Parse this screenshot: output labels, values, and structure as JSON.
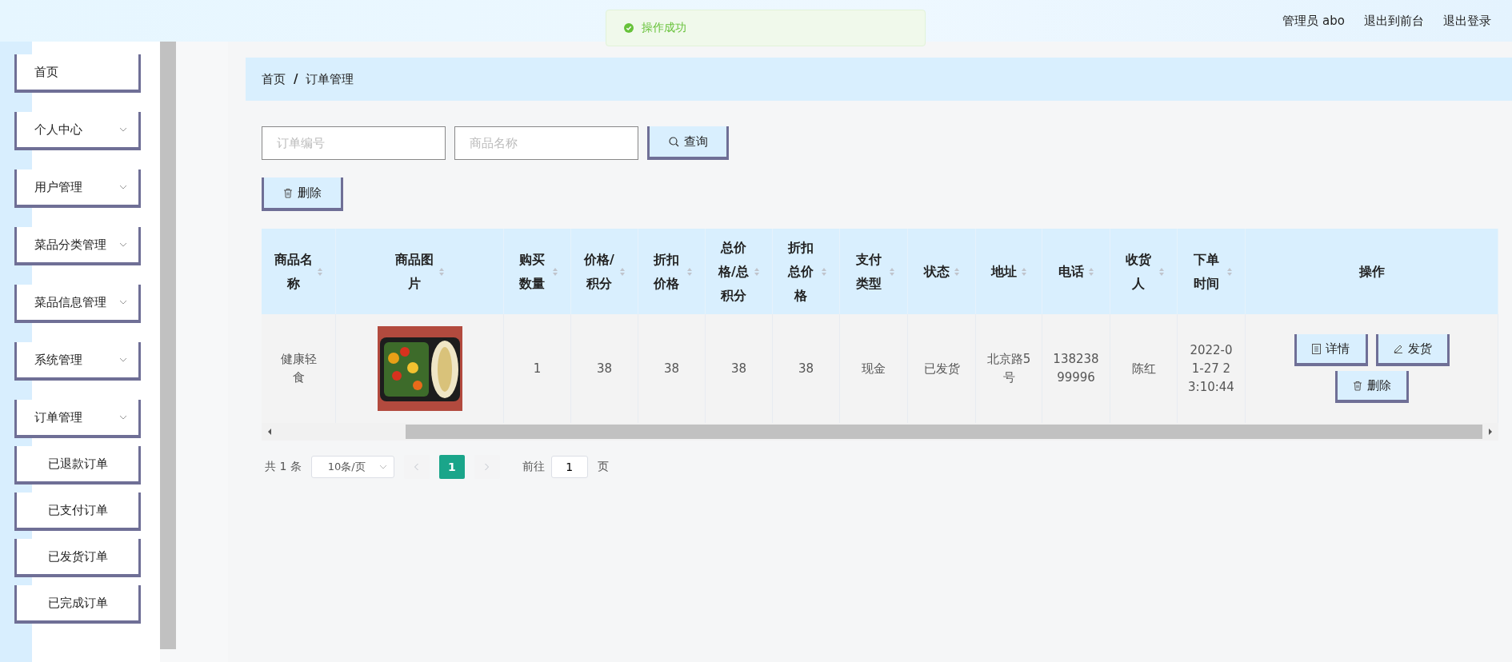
{
  "header": {
    "user_label": "管理员 abo",
    "links": [
      "退出到前台",
      "退出登录"
    ]
  },
  "toast": {
    "kind": "success",
    "message": "操作成功"
  },
  "sidebar": {
    "items": [
      {
        "label": "首页",
        "kind": "link"
      },
      {
        "label": "个人中心",
        "kind": "submenu"
      },
      {
        "label": "用户管理",
        "kind": "submenu"
      },
      {
        "label": "菜品分类管理",
        "kind": "submenu"
      },
      {
        "label": "菜品信息管理",
        "kind": "submenu"
      },
      {
        "label": "系统管理",
        "kind": "submenu"
      },
      {
        "label": "订单管理",
        "kind": "submenu",
        "children": [
          {
            "label": "已退款订单"
          },
          {
            "label": "已支付订单"
          },
          {
            "label": "已发货订单"
          },
          {
            "label": "已完成订单"
          }
        ]
      }
    ]
  },
  "breadcrumb": [
    "首页",
    "订单管理"
  ],
  "breadcrumb_separator": "/",
  "search": {
    "fields": [
      {
        "placeholder": "订单编号"
      },
      {
        "placeholder": "商品名称"
      }
    ],
    "button": "查询"
  },
  "toolbar": {
    "delete_button": "删除"
  },
  "table": {
    "columns": [
      {
        "label": "商品名称",
        "sortable": true
      },
      {
        "label": "商品图片",
        "sortable": true
      },
      {
        "label": "购买数量",
        "sortable": true
      },
      {
        "label": "价格/积分",
        "sortable": true
      },
      {
        "label": "折扣价格",
        "sortable": true
      },
      {
        "label": "总价格/总积分",
        "sortable": true
      },
      {
        "label": "折扣总价格",
        "sortable": true
      },
      {
        "label": "支付类型",
        "sortable": true
      },
      {
        "label": "状态",
        "sortable": true
      },
      {
        "label": "地址",
        "sortable": true
      },
      {
        "label": "电话",
        "sortable": true
      },
      {
        "label": "收货人",
        "sortable": true
      },
      {
        "label": "下单时间",
        "sortable": true
      },
      {
        "label": "操作",
        "sortable": false
      }
    ],
    "rows": [
      {
        "cells": [
          {
            "kind": "text",
            "text": "健康轻食"
          },
          {
            "kind": "picture"
          },
          {
            "kind": "text",
            "text": "1"
          },
          {
            "kind": "text",
            "text": "38"
          },
          {
            "kind": "text",
            "text": "38"
          },
          {
            "kind": "text",
            "text": "38"
          },
          {
            "kind": "text",
            "text": "38"
          },
          {
            "kind": "text",
            "text": "现金"
          },
          {
            "kind": "text",
            "text": "已发货"
          },
          {
            "kind": "text",
            "text": "北京路5号"
          },
          {
            "kind": "text",
            "text": "13823899996"
          },
          {
            "kind": "text",
            "text": "陈红"
          },
          {
            "kind": "text",
            "text": "2022-01-27 23:10:44"
          },
          {
            "kind": "actions",
            "buttons": [
              {
                "label": "详情",
                "kind": "detail"
              },
              {
                "label": "发货",
                "kind": "edit"
              },
              {
                "label": "删除",
                "kind": "delete"
              }
            ]
          }
        ]
      }
    ]
  },
  "pagination": {
    "total": "共 1 条",
    "page_size": "10条/页",
    "prev_disabled": true,
    "next_disabled": true,
    "pages": [
      {
        "label": "1",
        "selected": true
      }
    ],
    "goto_label": "前往",
    "goto_value": "1",
    "goto_suffix": "页"
  }
}
